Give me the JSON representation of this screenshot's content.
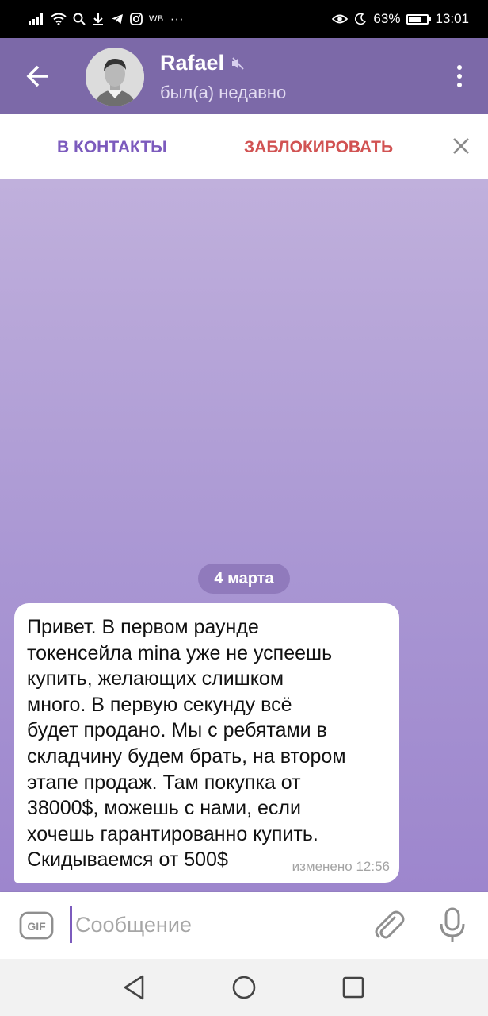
{
  "status_bar": {
    "left_small": "WB",
    "more": "···",
    "battery": "63%",
    "battery_level": 0.63,
    "time": "13:01"
  },
  "header": {
    "name": "Rafael",
    "status": "был(а) недавно",
    "icons": [
      "back-arrow-icon",
      "avatar",
      "muted-speaker-icon",
      "more-vert-icon"
    ]
  },
  "action_bar": {
    "add_contact": "В КОНТАКТЫ",
    "block": "ЗАБЛОКИРОВАТЬ",
    "close_icon": "close-icon"
  },
  "chat": {
    "date": "4 марта",
    "message": {
      "text": "Привет. В первом раунде\nтокенсейла mina уже не успеешь\nкупить, желающих слишком\nмного. В первую секунду всё\nбудет продано. Мы с ребятами в\nскладчину будем брать, на втором\nэтапе продаж. Там покупка от\n38000$, можешь с нами, если\nхочешь гарантированно купить.\nСкидываемся от 500$",
      "meta": "изменено 12:56"
    }
  },
  "compose": {
    "placeholder": "Сообщение",
    "gif_label": "GIF",
    "icons": [
      "gif-icon",
      "paperclip-icon",
      "microphone-icon"
    ]
  },
  "colors": {
    "header_bg": "#7c69a8",
    "accent_purple": "#7c5bbd",
    "block_red": "#d15353",
    "chat_bg_top": "#c0b0dc",
    "chat_bg_bottom": "#9d86cd"
  }
}
